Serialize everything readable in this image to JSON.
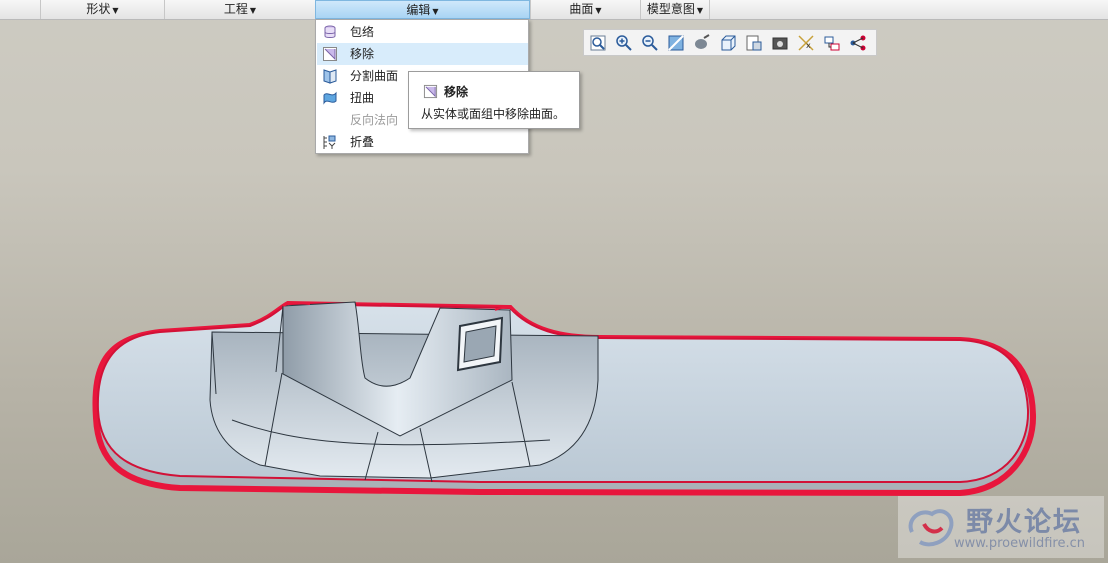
{
  "ribbon": {
    "groups": [
      {
        "label": "形状"
      },
      {
        "label": "工程"
      },
      {
        "label": "编辑"
      },
      {
        "label": "曲面"
      },
      {
        "label": "模型意图"
      }
    ]
  },
  "view_toolbar": {
    "icons": [
      "refit-icon",
      "zoom-in-icon",
      "zoom-out-icon",
      "repaint-icon",
      "display-style-icon",
      "saved-orientations-icon",
      "view-manager-icon",
      "perspective-icon",
      "datum-display-icon",
      "spin-center-icon",
      "annotation-display-icon"
    ]
  },
  "edit_menu": {
    "items": [
      {
        "label": "包络",
        "icon": "wrap-icon",
        "enabled": true,
        "highlighted": false
      },
      {
        "label": "移除",
        "icon": "remove-icon",
        "enabled": true,
        "highlighted": true
      },
      {
        "label": "分割曲面",
        "icon": "split-surface-icon",
        "enabled": true,
        "highlighted": false
      },
      {
        "label": "扭曲",
        "icon": "warp-icon",
        "enabled": true,
        "highlighted": false
      },
      {
        "label": "反向法向",
        "icon": "",
        "enabled": false,
        "highlighted": false
      },
      {
        "label": "折叠",
        "icon": "fold-icon",
        "enabled": true,
        "highlighted": false
      }
    ]
  },
  "tooltip": {
    "title": "移除",
    "description": "从实体或面组中移除曲面。"
  },
  "watermark": {
    "brand": "野火论坛",
    "url": "www.proewildfire.cn"
  },
  "colors": {
    "active_group": "#a9d4f4",
    "menu_highlight": "#d8ecfb",
    "edge_highlight": "#e8163c",
    "model_surface": "#c7d4de"
  }
}
